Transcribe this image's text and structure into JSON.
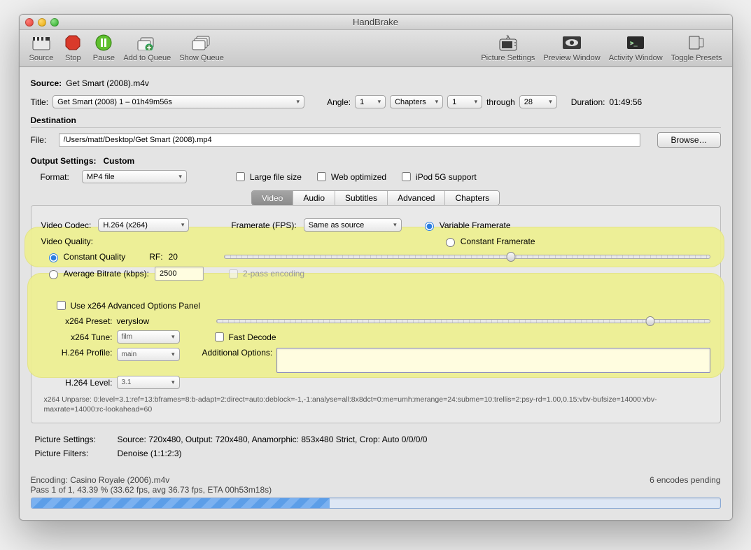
{
  "window_title": "HandBrake",
  "toolbar": {
    "source": "Source",
    "stop": "Stop",
    "pause": "Pause",
    "add_queue": "Add to Queue",
    "show_queue": "Show Queue",
    "pic_settings": "Picture Settings",
    "preview": "Preview Window",
    "activity": "Activity Window",
    "toggle_presets": "Toggle Presets"
  },
  "source": {
    "label": "Source:",
    "value": "Get Smart (2008).m4v"
  },
  "title_row": {
    "label": "Title:",
    "title_value": "Get Smart (2008) 1 – 01h49m56s",
    "angle_label": "Angle:",
    "angle_value": "1",
    "chapters_label": "Chapters",
    "chap_from": "1",
    "through": "through",
    "chap_to": "28",
    "duration_label": "Duration:",
    "duration_value": "01:49:56"
  },
  "destination": {
    "header": "Destination",
    "file_label": "File:",
    "file_value": "/Users/matt/Desktop/Get Smart (2008).mp4",
    "browse": "Browse…"
  },
  "output": {
    "header_label": "Output Settings:",
    "header_value": "Custom",
    "format_label": "Format:",
    "format_value": "MP4 file",
    "large_file": "Large file size",
    "web_opt": "Web optimized",
    "ipod": "iPod 5G support"
  },
  "tabs": {
    "video": "Video",
    "audio": "Audio",
    "subtitles": "Subtitles",
    "advanced": "Advanced",
    "chapters": "Chapters"
  },
  "video": {
    "codec_label": "Video Codec:",
    "codec_value": "H.264 (x264)",
    "fps_label": "Framerate (FPS):",
    "fps_value": "Same as source",
    "vfr": "Variable Framerate",
    "cfr": "Constant Framerate",
    "quality_header": "Video Quality:",
    "cq_label": "Constant Quality",
    "rf_label": "RF:",
    "rf_value": "20",
    "abr_label": "Average Bitrate (kbps):",
    "abr_value": "2500",
    "twopass": "2-pass encoding",
    "adv_panel": "Use x264 Advanced Options Panel",
    "preset_label": "x264 Preset:",
    "preset_value": "veryslow",
    "tune_label": "x264 Tune:",
    "tune_value": "film",
    "fast_decode": "Fast Decode",
    "profile_label": "H.264 Profile:",
    "profile_value": "main",
    "aopts_label": "Additional Options:",
    "aopts_value": "",
    "level_label": "H.264 Level:",
    "level_value": "3.1",
    "unparse": "x264 Unparse: 0:level=3.1:ref=13:bframes=8:b-adapt=2:direct=auto:deblock=-1,-1:analyse=all:8x8dct=0:me=umh:merange=24:subme=10:trellis=2:psy-rd=1.00,0.15:vbv-bufsize=14000:vbv-maxrate=14000:rc-lookahead=60"
  },
  "pic_info": {
    "settings_label": "Picture Settings:",
    "settings_value": "Source: 720x480, Output: 720x480, Anamorphic: 853x480 Strict, Crop: Auto 0/0/0/0",
    "filters_label": "Picture Filters:",
    "filters_value": "Denoise (1:1:2:3)"
  },
  "status": {
    "encoding": "Encoding: Casino Royale (2006).m4v",
    "pass": "Pass 1 of 1, 43.39 % (33.62 fps, avg 36.73 fps, ETA 00h53m18s)",
    "pending": "6 encodes pending",
    "progress_pct": 43.39
  }
}
